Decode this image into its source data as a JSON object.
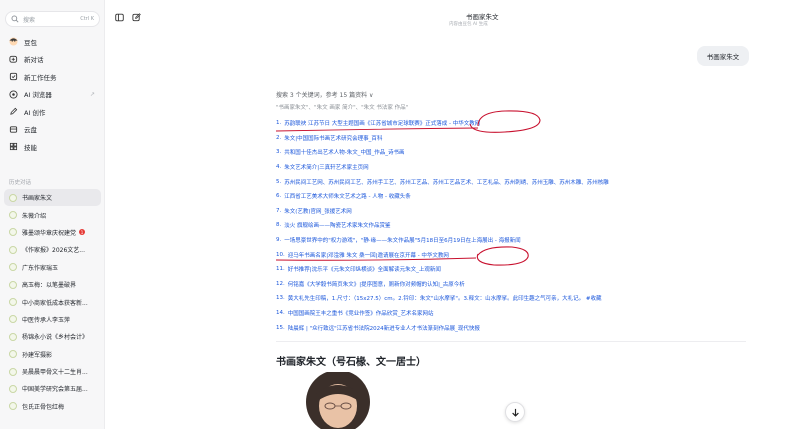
{
  "sidebar": {
    "search_placeholder": "搜索",
    "search_shortcut": "Ctrl K",
    "nav": [
      {
        "label": "豆包",
        "icon": "doubao-avatar-icon"
      },
      {
        "label": "新对话",
        "icon": "new-chat-icon"
      },
      {
        "label": "新工作任务",
        "icon": "task-icon"
      },
      {
        "label": "AI 浏览器",
        "icon": "browser-icon",
        "ext": "↗"
      },
      {
        "label": "AI 创作",
        "icon": "create-icon"
      },
      {
        "label": "云盘",
        "icon": "cloud-drive-icon"
      },
      {
        "label": "技能",
        "icon": "skills-icon"
      }
    ],
    "history_label": "历史对话",
    "history": [
      {
        "label": "书画家朱文",
        "active": true
      },
      {
        "label": "朱薇介绍"
      },
      {
        "label": "雅墨颂华章庆祝建党",
        "badge": "1"
      },
      {
        "label": "《作家报》2026文艺..."
      },
      {
        "label": "广东作家瑞玉"
      },
      {
        "label": "高玉梅：以笔墨破界"
      },
      {
        "label": "中小商家低成本获客新..."
      },
      {
        "label": "中医传承人李玉萍"
      },
      {
        "label": "杨锦永小说《乡村会计》"
      },
      {
        "label": "孙建军摄影"
      },
      {
        "label": "吴晨晨甲骨文十二生肖..."
      },
      {
        "label": "中国美学研究会第五届..."
      },
      {
        "label": "包氏正骨包红梅"
      }
    ]
  },
  "header": {
    "title": "书画家朱文",
    "subtitle": "内容由豆包 AI 生成"
  },
  "chat": {
    "user_message": "书画家朱文",
    "search_summary": "搜索 3 个关键词，参考 15 篇资料 ∨",
    "queries": "\"书画家朱文\"、\"朱文 画家 简介\"、\"朱文 书法家 作品\"",
    "references": [
      {
        "num": "1.",
        "text": "苏韵联袂 江苏节日 大型主题国画《江苏省城市足球联赛》正式落成 - 中华文教网"
      },
      {
        "num": "2.",
        "text": "朱文|中国国际书画艺术研究会理事_百科"
      },
      {
        "num": "3.",
        "text": "共和国十佳杰出艺术人物-朱文_中国_作品_诗书画"
      },
      {
        "num": "4.",
        "text": "朱文艺术简介|三真轩艺术家主页网"
      },
      {
        "num": "5.",
        "text": "苏州民间工艺网、苏州民间工艺、苏州手工艺、苏州工艺品、苏州工艺品艺术、工艺礼品、苏州刺绣、苏州玉雕、苏州木雕、苏州核雕"
      },
      {
        "num": "6.",
        "text": "江西省工艺美术大师朱文艺术之路 - 人物 - 收藏头条"
      },
      {
        "num": "7.",
        "text": "朱文(艺教)官网_张援艺术网"
      },
      {
        "num": "8.",
        "text": "淡火 旗舰绘画——陶瓷艺术家朱文作品赏鉴"
      },
      {
        "num": "9.",
        "text": "一场思豪世界中的\"权力游戏\"，\"静·缘——朱文作品展\"5月18日至6月19日在上海展出 - 海报新闻"
      },
      {
        "num": "10.",
        "text": "迎马年书画名家|邓淦雅 朱文 桑一回|邀请展在京开幕 - 中华文教网"
      },
      {
        "num": "11.",
        "text": "好书推荐|沈乐平《元朱文印纵横谈》全面解读元朱文_上观新闻"
      },
      {
        "num": "12.",
        "text": "何铭嘉《大学毅书简页朱文》|提序图意，厕新你对频帽的认知|_古原今析"
      },
      {
        "num": "13.",
        "text": "黄大礼先生印稿，1.尺寸：（15x27.5）cm。2.钤印：朱文\"山水摩挲\"。3.释文：山水摩挲。此印生趣之气可亲，大礼记。 #收藏"
      },
      {
        "num": "14.",
        "text": "中国国画院王丰之重书《竞业作签》作品欣赏_艺术名家网站"
      },
      {
        "num": "15.",
        "text": "陆晨辉 | \"众行致远\"江苏省书法院2024新进专业人才书法篆刻作品展_现代快报"
      }
    ],
    "answer_heading": "书画家朱文（号石椽、文一居士）"
  },
  "colors": {
    "link": "#1a56db",
    "annotation": "#c8102e",
    "active_bg": "#e9e9ec"
  }
}
